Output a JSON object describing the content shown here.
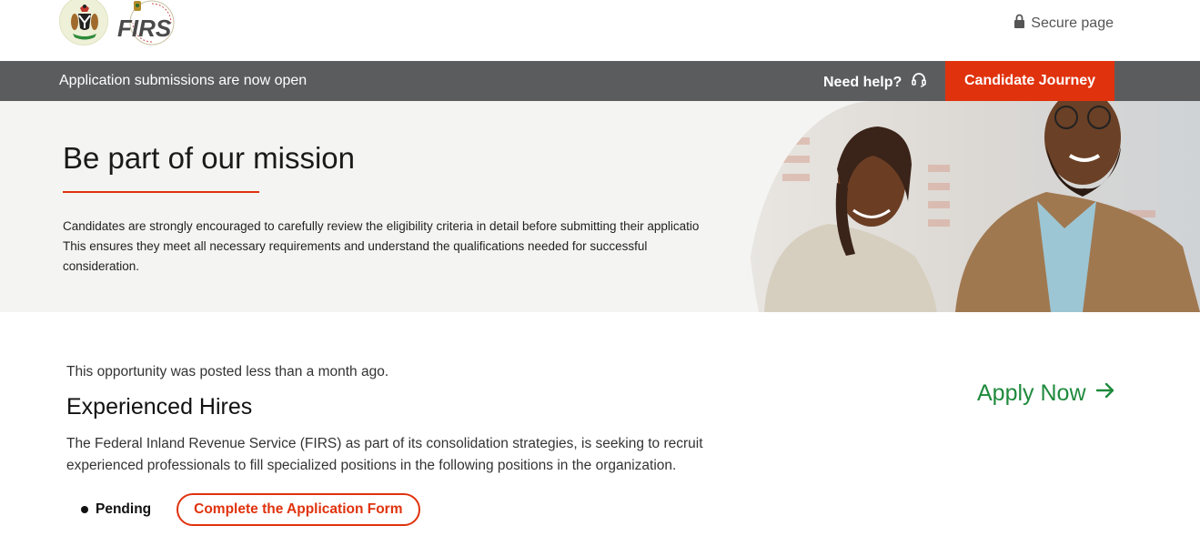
{
  "header": {
    "coat_of_arms_icon": "nigeria-coat-of-arms",
    "logo_text": "FIRS",
    "seal_text": "FEDERAL INLAND REVENUE SERVICE",
    "secure_label": "Secure page",
    "secure_icon": "lock-icon"
  },
  "banner": {
    "notice": "Application submissions are now open",
    "help_label": "Need help?",
    "help_icon": "headset-icon",
    "journey_button": "Candidate Journey"
  },
  "hero": {
    "title": "Be part of our mission",
    "text_lines": [
      "Candidates are strongly encouraged to carefully review the eligibility criteria in detail before submitting their applicatio",
      "This ensures they meet all necessary requirements and understand the qualifications needed for successful",
      "consideration."
    ]
  },
  "job": {
    "posted": "This opportunity was posted less than a month ago.",
    "title": "Experienced Hires",
    "description": "The Federal Inland Revenue Service (FIRS) as part of its consolidation strategies, is seeking to recruit experienced professionals to fill specialized positions in the following positions in the organization.",
    "apply_label": "Apply Now",
    "apply_icon": "arrow-right-icon",
    "status": "Pending",
    "form_button": "Complete the Application Form"
  },
  "colors": {
    "accent": "#e0320d",
    "bar": "#5b5c5e",
    "apply": "#1f8a3d",
    "hero_bg": "#f4f4f2"
  }
}
